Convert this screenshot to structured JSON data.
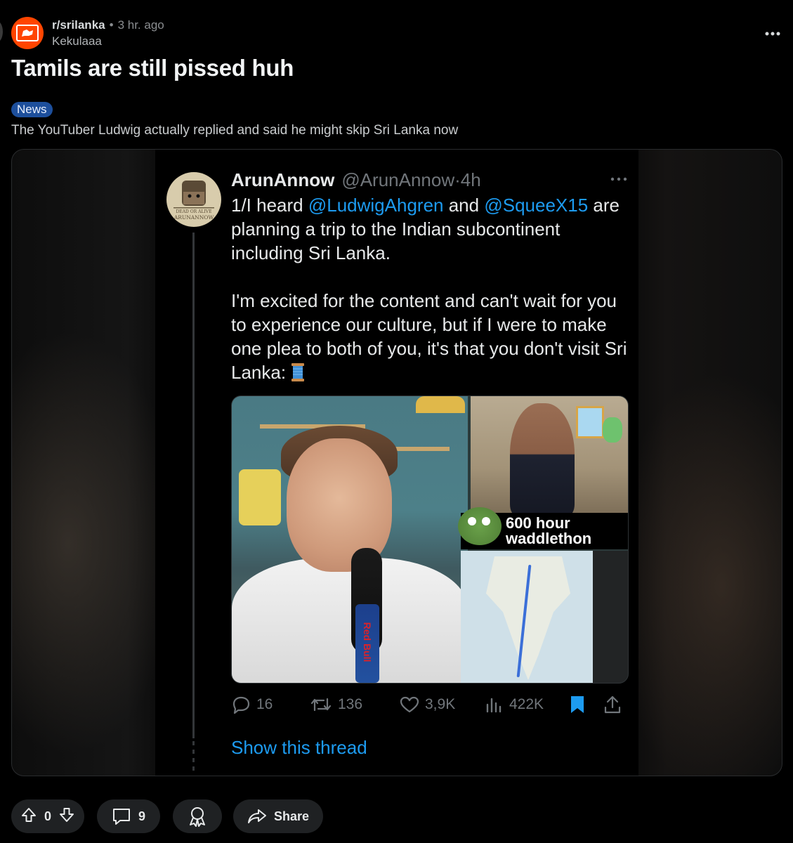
{
  "post": {
    "subreddit": "r/srilanka",
    "separator": "•",
    "time": "3 hr. ago",
    "author": "Kekulaaa",
    "title": "Tamils are still pissed huh",
    "flair": "News",
    "body": "The YouTuber Ludwig actually replied and said he might skip Sri Lanka now"
  },
  "tweet": {
    "name": "ArunAnnow",
    "handle_time": "@ArunAnnow·4h",
    "avatar_text_top": "DEAD OR ALIVE",
    "avatar_text_bottom": "ARUNANNOW",
    "line1_a": "1/I heard ",
    "mention1": "@LudwigAhgren",
    "line1_b": " and ",
    "mention2": "@SqueeX15",
    "line1_c": " are planning a trip to the Indian subcontinent including Sri Lanka.",
    "para2": "I'm excited for the content and can't wait for you to experience our culture, but if I were to make one plea to both of you, it's that you don't visit Sri Lanka: ",
    "image_caption_line1": "600 hour",
    "image_caption_line2": "waddlethon",
    "can_label": "Red Bull",
    "replies": "16",
    "retweets": "136",
    "likes": "3,9K",
    "views": "422K",
    "show_thread": "Show this thread"
  },
  "actions": {
    "votes": "0",
    "comments": "9",
    "share": "Share"
  },
  "colors": {
    "background": "#000000",
    "subreddit_icon": "#ff4500",
    "flair_bg": "#1d4f9c",
    "twitter_blue": "#1d9bf0",
    "pill_bg": "#1f2123"
  },
  "icons": {
    "more": "more-horizontal-icon",
    "reply": "reply-icon",
    "retweet": "retweet-icon",
    "like": "heart-icon",
    "views": "views-icon",
    "bookmark": "bookmark-icon",
    "share_tweet": "share-upload-icon",
    "upvote": "upvote-icon",
    "downvote": "downvote-icon",
    "comment": "comment-icon",
    "award": "award-icon",
    "share": "share-arrow-icon"
  }
}
